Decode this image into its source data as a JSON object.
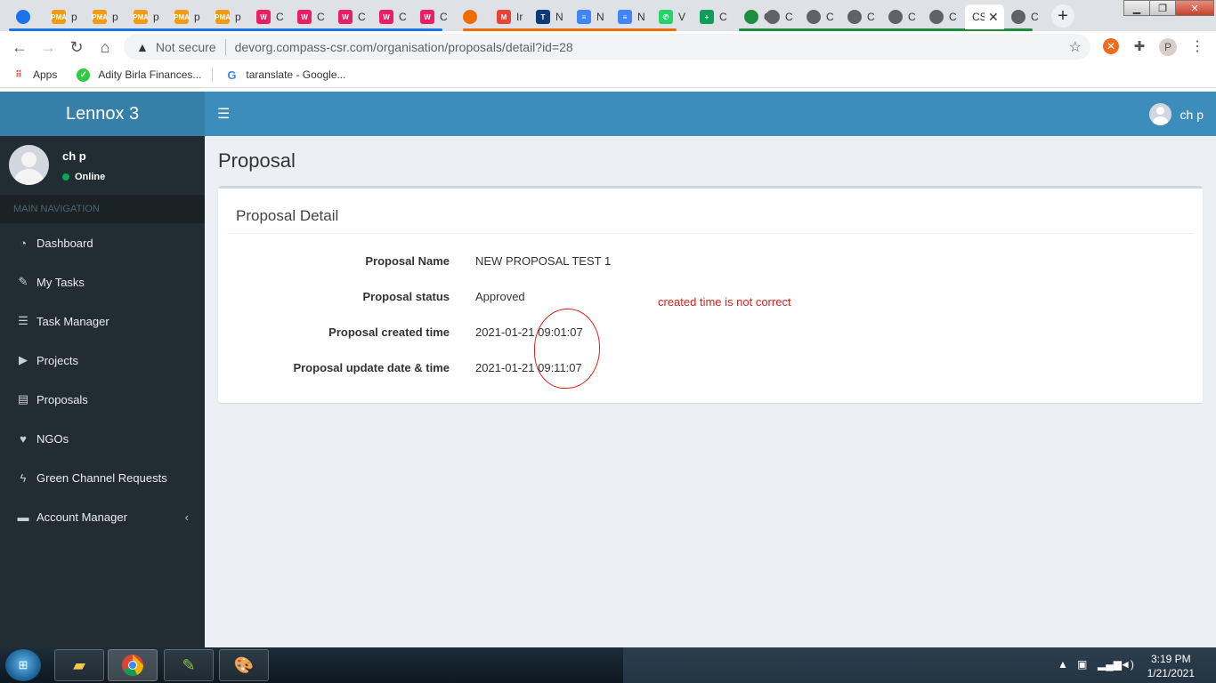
{
  "browser": {
    "tabs": [
      {
        "title": "",
        "color": "#1a73e8",
        "glyph": ""
      },
      {
        "title": "p",
        "color": "#f39c12",
        "glyph": "PMA"
      },
      {
        "title": "p",
        "color": "#f39c12",
        "glyph": "PMA"
      },
      {
        "title": "p",
        "color": "#f39c12",
        "glyph": "PMA"
      },
      {
        "title": "p",
        "color": "#f39c12",
        "glyph": "PMA"
      },
      {
        "title": "p",
        "color": "#f39c12",
        "glyph": "PMA"
      },
      {
        "title": "C",
        "color": "#e91e63",
        "glyph": "W"
      },
      {
        "title": "C",
        "color": "#e91e63",
        "glyph": "W"
      },
      {
        "title": "C",
        "color": "#e91e63",
        "glyph": "W"
      },
      {
        "title": "C",
        "color": "#e91e63",
        "glyph": "W"
      },
      {
        "title": "C",
        "color": "#e91e63",
        "glyph": "W"
      },
      {
        "title": "",
        "color": "#ef6c00",
        "glyph": ""
      },
      {
        "title": "Ir",
        "color": "#ea4335",
        "glyph": "M"
      },
      {
        "title": "N",
        "color": "#0f3c78",
        "glyph": "T"
      },
      {
        "title": "N",
        "color": "#4285f4",
        "glyph": "≡"
      },
      {
        "title": "N",
        "color": "#4285f4",
        "glyph": "≡"
      },
      {
        "title": "V",
        "color": "#25d366",
        "glyph": "✆"
      },
      {
        "title": "C",
        "color": "#0f9d58",
        "glyph": "+"
      },
      {
        "title": "C",
        "color": "#1e8e3e",
        "glyph": ""
      },
      {
        "title": "C",
        "color": "#5f6368",
        "glyph": ""
      },
      {
        "title": "C",
        "color": "#5f6368",
        "glyph": ""
      },
      {
        "title": "C",
        "color": "#5f6368",
        "glyph": ""
      },
      {
        "title": "C",
        "color": "#5f6368",
        "glyph": ""
      },
      {
        "title": "C",
        "color": "#5f6368",
        "glyph": ""
      },
      {
        "title": "CS",
        "color": "#ffffff",
        "glyph": "",
        "active": true
      },
      {
        "title": "C",
        "color": "#5f6368",
        "glyph": ""
      }
    ],
    "not_secure_label": "Not secure",
    "url": "devorg.compass-csr.com/organisation/proposals/detail?id=28",
    "bookmarks": [
      {
        "label": "Apps",
        "icon": "apps-grid-icon"
      },
      {
        "label": "Adity Birla Finances...",
        "icon": "check-circle-icon"
      },
      {
        "label": "taranslate - Google...",
        "icon": "google-icon"
      }
    ]
  },
  "app": {
    "brand": "Lennox 3",
    "top_user": "ch p",
    "sidebar": {
      "user_name": "ch p",
      "status": "Online",
      "header": "MAIN NAVIGATION",
      "items": [
        {
          "label": "Dashboard",
          "icon": "pie-chart-icon",
          "glyph": "◔"
        },
        {
          "label": "My Tasks",
          "icon": "edit-icon",
          "glyph": "✎"
        },
        {
          "label": "Task Manager",
          "icon": "list-icon",
          "glyph": "☰"
        },
        {
          "label": "Projects",
          "icon": "play-icon",
          "glyph": "▶"
        },
        {
          "label": "Proposals",
          "icon": "newspaper-icon",
          "glyph": "▤"
        },
        {
          "label": "NGOs",
          "icon": "heartbeat-icon",
          "glyph": "♥"
        },
        {
          "label": "Green Channel Requests",
          "icon": "bolt-icon",
          "glyph": "ϟ"
        },
        {
          "label": "Account Manager",
          "icon": "folder-icon",
          "glyph": "▬",
          "chevron": "‹"
        }
      ]
    },
    "page_title": "Proposal",
    "box_title": "Proposal Detail",
    "fields": [
      {
        "label": "Proposal Name",
        "value": "NEW PROPOSAL TEST 1"
      },
      {
        "label": "Proposal status",
        "value": "Approved"
      },
      {
        "label": "Proposal created time",
        "value": "2021-01-21 09:01:07"
      },
      {
        "label": "Proposal update date & time",
        "value": "2021-01-21 09:11:07"
      }
    ],
    "annotation": "created time is not correct"
  },
  "taskbar": {
    "time": "3:19 PM",
    "date": "1/21/2021"
  }
}
